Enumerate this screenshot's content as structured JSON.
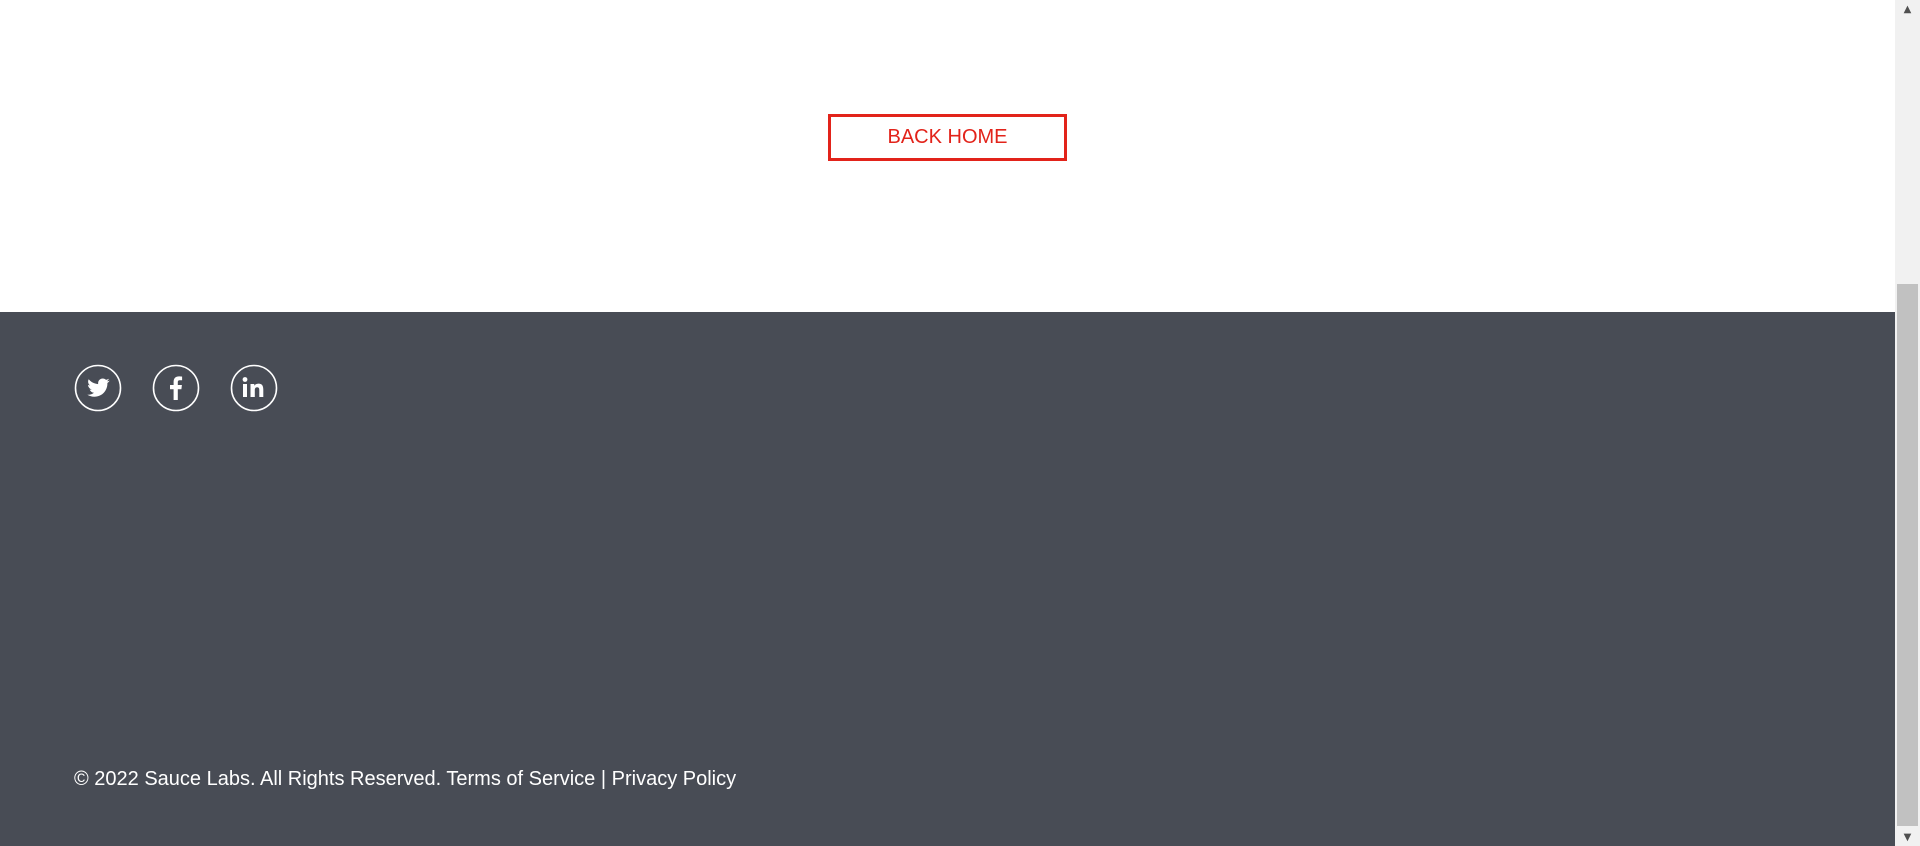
{
  "main": {
    "back_home_label": "BACK HOME"
  },
  "footer": {
    "social": [
      {
        "name": "twitter",
        "icon": "twitter-icon"
      },
      {
        "name": "facebook",
        "icon": "facebook-icon"
      },
      {
        "name": "linkedin",
        "icon": "linkedin-icon"
      }
    ],
    "copyright": "© 2022 Sauce Labs. All Rights Reserved.",
    "terms_label": "Terms of Service",
    "separator": "|",
    "privacy_label": "Privacy Policy"
  },
  "scrollbar": {
    "up_arrow": "▲",
    "down_arrow": "▼"
  },
  "colors": {
    "accent": "#e2231a",
    "footer_bg": "#484c55",
    "footer_text": "#ffffff",
    "page_bg": "#ffffff"
  }
}
